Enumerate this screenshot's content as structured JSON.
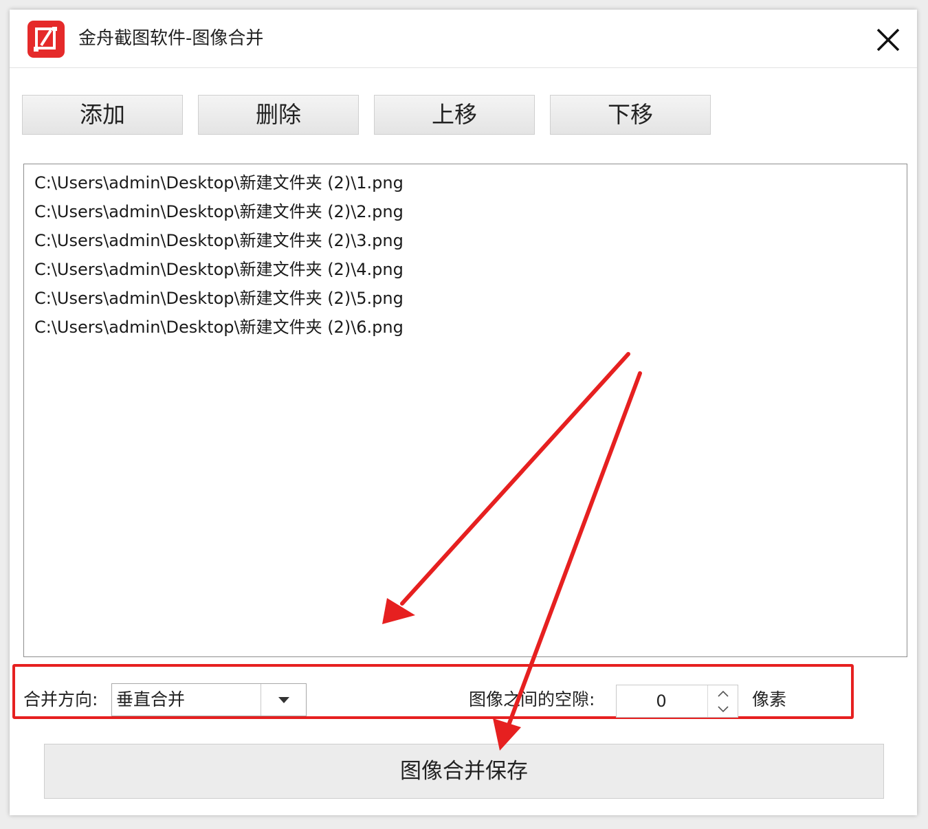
{
  "window": {
    "title": "金舟截图软件-图像合并"
  },
  "toolbar": {
    "add_label": "添加",
    "delete_label": "删除",
    "move_up_label": "上移",
    "move_down_label": "下移"
  },
  "files": [
    "C:\\Users\\admin\\Desktop\\新建文件夹 (2)\\1.png",
    "C:\\Users\\admin\\Desktop\\新建文件夹 (2)\\2.png",
    "C:\\Users\\admin\\Desktop\\新建文件夹 (2)\\3.png",
    "C:\\Users\\admin\\Desktop\\新建文件夹 (2)\\4.png",
    "C:\\Users\\admin\\Desktop\\新建文件夹 (2)\\5.png",
    "C:\\Users\\admin\\Desktop\\新建文件夹 (2)\\6.png"
  ],
  "options": {
    "direction_label": "合并方向:",
    "direction_value": "垂直合并",
    "gap_label": "图像之间的空隙:",
    "gap_value": "0",
    "gap_unit": "像素"
  },
  "save_button": {
    "label": "图像合并保存"
  },
  "colors": {
    "accent": "#e62020",
    "app_icon": "#e52a2a",
    "window_bg": "#ffffff",
    "button_bg": "#ececec"
  },
  "icons": {
    "app": "app-logo-icon",
    "close": "close-icon",
    "dropdown": "chevron-down-icon",
    "spin_up": "chevron-up-icon",
    "spin_down": "chevron-down-icon"
  }
}
